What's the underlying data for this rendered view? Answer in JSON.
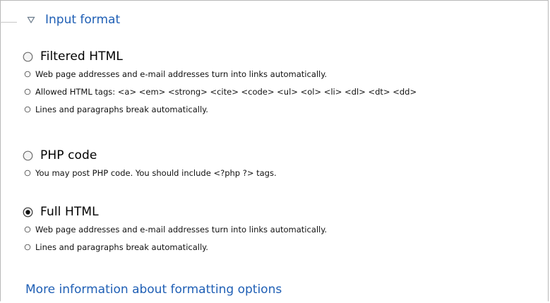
{
  "fieldset": {
    "legend": "Input format",
    "toggle_icon": "triangle-down-icon"
  },
  "options": [
    {
      "label": "Filtered HTML",
      "selected": false,
      "tips": [
        "Web page addresses and e-mail addresses turn into links automatically.",
        "Allowed HTML tags: <a> <em> <strong> <cite> <code> <ul> <ol> <li> <dl> <dt> <dd>",
        "Lines and paragraphs break automatically."
      ]
    },
    {
      "label": "PHP code",
      "selected": false,
      "tips": [
        "You may post PHP code. You should include <?php ?> tags."
      ]
    },
    {
      "label": "Full HTML",
      "selected": true,
      "tips": [
        "Web page addresses and e-mail addresses turn into links automatically.",
        "Lines and paragraphs break automatically."
      ]
    }
  ],
  "more_link": "More information about formatting options",
  "colors": {
    "link": "#1f5fb5",
    "border": "#b8b8b8"
  }
}
